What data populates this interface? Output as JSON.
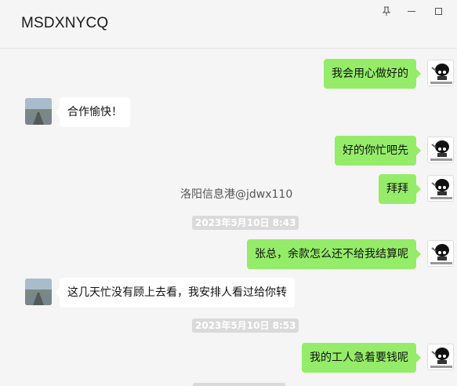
{
  "window": {
    "title": "MSDXNYCQ",
    "controls": {
      "pin_icon": "pin-icon",
      "minimize_icon": "minimize-icon",
      "maximize_icon": "maximize-icon"
    }
  },
  "overlay": {
    "watermark": "洛阳信息港@jdwx110"
  },
  "messages": [
    {
      "side": "me",
      "text": "我会用心做好的"
    },
    {
      "side": "other",
      "text": "合作愉快！"
    },
    {
      "side": "me",
      "text": "好的你忙吧先"
    },
    {
      "side": "me",
      "text": "拜拜"
    },
    {
      "side": "time",
      "text": "2023年5月10日 8:43"
    },
    {
      "side": "me",
      "text": "张总，余款怎么还不给我结算呢"
    },
    {
      "side": "other",
      "text": "这几天忙没有顾上去看，我安排人看过给你转"
    },
    {
      "side": "time",
      "text": "2023年5月10日 8:53"
    },
    {
      "side": "me",
      "text": "我的工人急着要钱呢"
    }
  ],
  "colors": {
    "my_bubble": "#95ec69",
    "their_bubble": "#ffffff",
    "background": "#f5f5f5",
    "time_badge": "#dadada"
  }
}
